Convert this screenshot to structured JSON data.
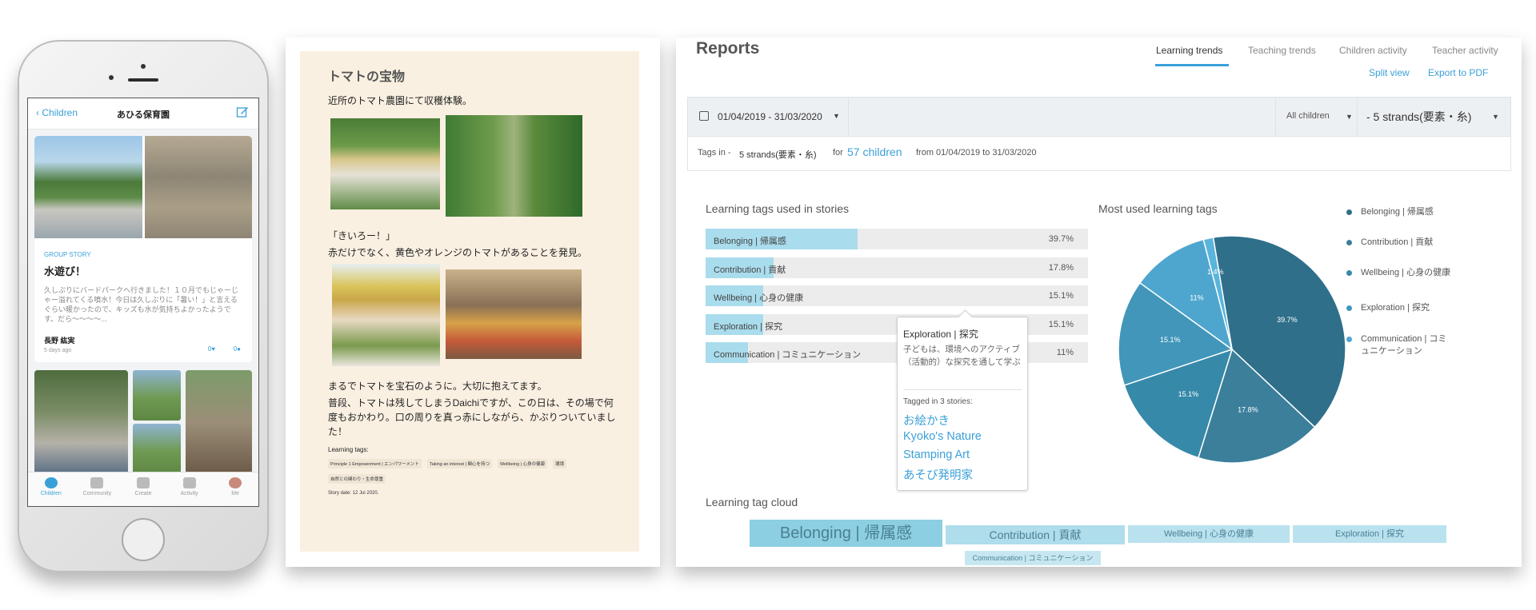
{
  "phone": {
    "nav": {
      "back_label": "Children",
      "title": "あひる保育園"
    },
    "story": {
      "tag": "GROUP STORY",
      "title": "水遊び！",
      "body": "久しぶりにバードパークへ行きました！１０月でもじゃーじゃー溢れてくる噴水！今日は久しぶりに「暑い！」と言えるぐらい暖かったので、キッズも水が気持ちよかったようです。だら〜〜〜〜...",
      "author": "長野 紘実",
      "time": "5 days ago",
      "likes": "0",
      "comments": "0"
    },
    "tabs": [
      {
        "label": "Children"
      },
      {
        "label": "Community"
      },
      {
        "label": "Create"
      },
      {
        "label": "Activity"
      },
      {
        "label": "Me"
      }
    ]
  },
  "story_doc": {
    "title": "トマトの宝物",
    "p1": "近所のトマト農園にて収穫体験。",
    "p2": "「きいろー！」",
    "p3": "赤だけでなく、黄色やオレンジのトマトがあることを発見。",
    "p4": "まるでトマトを宝石のように。大切に抱えてます。",
    "p5": "普段、トマトは残してしまうDaichiですが、この日は、その場で何度もおかわり。口の周りを真っ赤にしながら、かぶりついていました！",
    "tags_label": "Learning tags:",
    "tags": [
      "Principle 1 Empowerment | エンパワーメント",
      "Taking an interest | 関心を持つ",
      "Wellbeing | 心身の健康",
      "環境",
      "自然との関わり・生命尊重"
    ],
    "date": "Story date: 12 Jul 2020."
  },
  "reports": {
    "title": "Reports",
    "tabs": [
      "Learning trends",
      "Teaching trends",
      "Children activity",
      "Teacher activity"
    ],
    "links": {
      "split": "Split view",
      "export": "Export to PDF"
    },
    "filter": {
      "date_range": "01/04/2019 - 31/03/2020",
      "children": "All children",
      "strands": "- 5 strands(要素・糸)"
    },
    "summary": {
      "prefix": "Tags in -",
      "strands": "5 strands(要素・糸)",
      "for": "for",
      "children": "57 children",
      "range": "from 01/04/2019 to 31/03/2020"
    },
    "bars_title": "Learning tags used in stories",
    "pie_title": "Most used learning tags",
    "tooltip": {
      "title": "Exploration | 探究",
      "desc": "子どもは、環境へのアクティブ（活動的）な探究を通して学ぶ",
      "tagged": "Tagged in 3 stories:",
      "stories": [
        "お絵かき",
        "Kyoko's Nature",
        "Stamping Art",
        "あそび発明家"
      ]
    },
    "cloud_title": "Learning tag cloud",
    "cloud_tags": [
      "Belonging | 帰属感",
      "Contribution | 貢献",
      "Wellbeing | 心身の健康",
      "Exploration | 探究",
      "Communication | コミュニケーション"
    ]
  },
  "chart_data": [
    {
      "type": "bar",
      "title": "Learning tags used in stories",
      "categories": [
        "Belonging | 帰属感",
        "Contribution | 貢献",
        "Wellbeing | 心身の健康",
        "Exploration | 探究",
        "Communication | コミュニケーション"
      ],
      "values": [
        39.7,
        17.8,
        15.1,
        15.1,
        11
      ],
      "value_labels": [
        "39.7%",
        "17.8%",
        "15.1%",
        "15.1%",
        "11%"
      ]
    },
    {
      "type": "pie",
      "title": "Most used learning tags",
      "labels": [
        "Belonging | 帰属感",
        "Contribution | 貢献",
        "Wellbeing | 心身の健康",
        "Exploration | 探究",
        "Communication | コミュニケーション"
      ],
      "values": [
        39.7,
        17.8,
        15.1,
        15.1,
        11,
        1.4
      ],
      "value_labels": [
        "39.7%",
        "17.8%",
        "15.1%",
        "15.1%",
        "11%",
        "1.4%"
      ],
      "colors": [
        "#2f6f8a",
        "#3b7f9b",
        "#3689a8",
        "#4196ba",
        "#4ea6cf",
        "#5ab4dc"
      ],
      "legend_position": "right"
    }
  ],
  "colors": {
    "accent": "#3aa0d8",
    "bar_fill": "#a9dcec",
    "cloud_fill": "#8ccfe2"
  }
}
